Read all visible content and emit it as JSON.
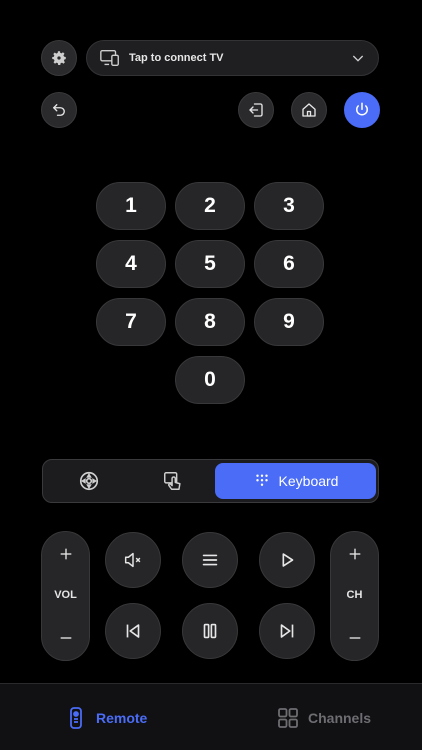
{
  "header": {
    "connect_label": "Tap to connect TV"
  },
  "keypad": {
    "digits": [
      "1",
      "2",
      "3",
      "4",
      "5",
      "6",
      "7",
      "8",
      "9",
      "0"
    ]
  },
  "segmented": {
    "active_label": "Keyboard"
  },
  "controls": {
    "vol_label": "VOL",
    "ch_label": "CH"
  },
  "tabbar": {
    "remote_label": "Remote",
    "channels_label": "Channels"
  },
  "colors": {
    "accent": "#4a6cf7",
    "background": "#000000",
    "button": "#262628"
  }
}
